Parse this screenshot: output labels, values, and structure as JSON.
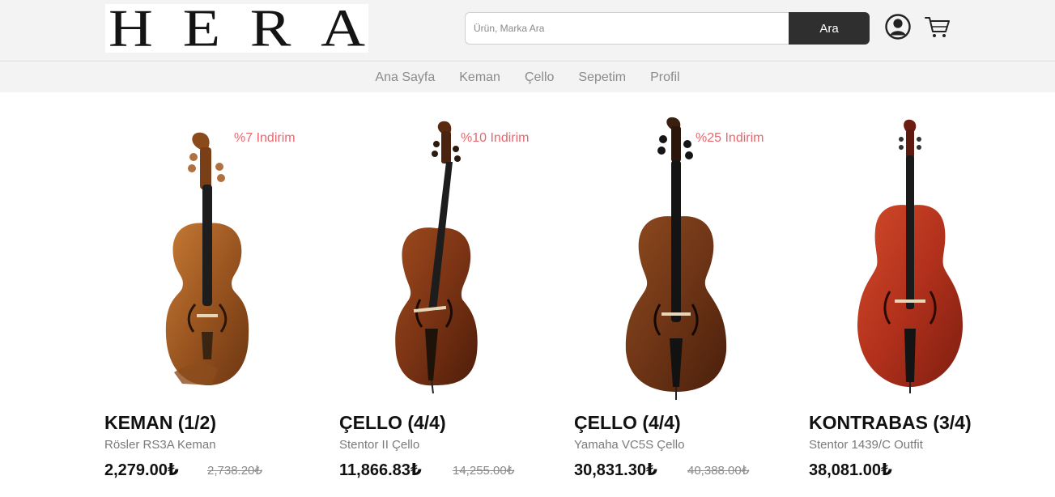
{
  "brand": {
    "logo_letters": [
      "H",
      "E",
      "R",
      "A"
    ]
  },
  "search": {
    "placeholder": "Ürün, Marka Ara",
    "button_label": "Ara"
  },
  "header_icons": {
    "user": "user-icon",
    "cart": "cart-icon"
  },
  "nav": {
    "items": [
      "Ana Sayfa",
      "Keman",
      "Çello",
      "Sepetim",
      "Profil"
    ]
  },
  "colors": {
    "accent_discount": "#e8676f",
    "button_dark": "#2f2f2f",
    "bar_bg": "#f3f3f3"
  },
  "products": [
    {
      "title": "KEMAN (1/2)",
      "subtitle": "Rösler RS3A Keman",
      "price": "2,279.00₺",
      "old_price": "2,738.20₺",
      "discount": "%7 Indirim",
      "image": "violin"
    },
    {
      "title": "ÇELLO (4/4)",
      "subtitle": "Stentor II Çello",
      "price": "11,866.83₺",
      "old_price": "14,255.00₺",
      "discount": "%10 Indirim",
      "image": "cello"
    },
    {
      "title": "ÇELLO (4/4)",
      "subtitle": "Yamaha VC5S Çello",
      "price": "30,831.30₺",
      "old_price": "40,388.00₺",
      "discount": "%25 Indirim",
      "image": "cello"
    },
    {
      "title": "KONTRABAS (3/4)",
      "subtitle": "Stentor 1439/C Outfit",
      "price": "38,081.00₺",
      "old_price": "",
      "discount": "",
      "image": "double-bass"
    }
  ]
}
